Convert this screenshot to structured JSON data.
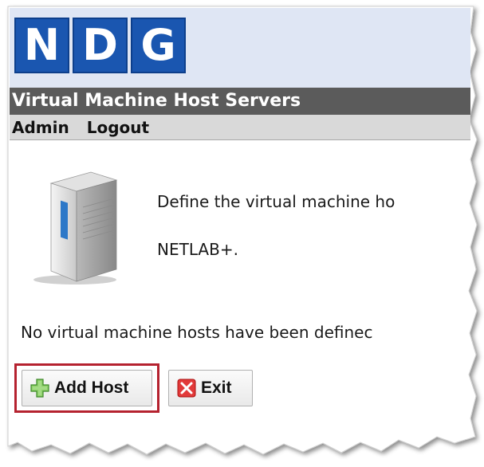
{
  "logo": {
    "letters": [
      "N",
      "D",
      "G"
    ],
    "color": "#1a56b0"
  },
  "header": {
    "title": "Virtual Machine Host Servers"
  },
  "menu": {
    "items": [
      {
        "label": "Admin"
      },
      {
        "label": "Logout"
      }
    ]
  },
  "content": {
    "intro_line1": "Define the virtual machine ho",
    "intro_line2": "NETLAB+.",
    "empty_message": "No virtual machine hosts have been definec",
    "icon": "server-tower-icon"
  },
  "actions": {
    "add_label": "Add Host",
    "add_icon": "green-plus-icon",
    "exit_label": "Exit",
    "exit_icon": "red-x-icon",
    "highlight_color": "#b5222f"
  }
}
